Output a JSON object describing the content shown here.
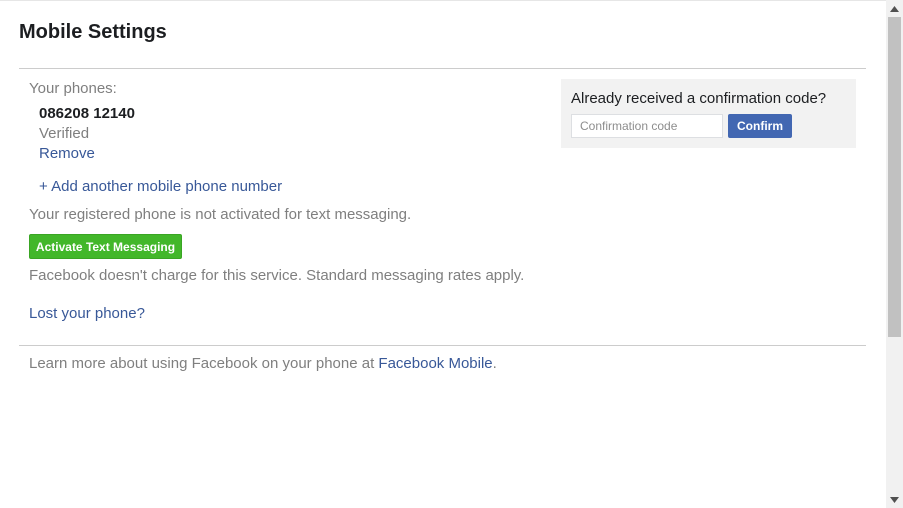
{
  "page": {
    "title": "Mobile Settings"
  },
  "phones": {
    "label": "Your phones:",
    "number": "086208 12140",
    "status": "Verified",
    "remove_label": "Remove",
    "add_label": "+ Add another mobile phone number"
  },
  "texting": {
    "status_text": "Your registered phone is not activated for text messaging.",
    "activate_label": "Activate Text Messaging",
    "charge_note": "Facebook doesn't charge for this service. Standard messaging rates apply.",
    "lost_phone_label": "Lost your phone?"
  },
  "footer": {
    "learn_more_prefix": "Learn more about using Facebook on your phone at ",
    "learn_more_link": "Facebook Mobile",
    "learn_more_suffix": "."
  },
  "confirm": {
    "heading": "Already received a confirmation code?",
    "input_placeholder": "Confirmation code",
    "input_value": "",
    "button_label": "Confirm"
  },
  "scrollbar": {
    "up_icon": "triangle-up-icon",
    "down_icon": "triangle-down-icon"
  },
  "colors": {
    "link": "#385898",
    "activate_button": "#42b72a",
    "confirm_button": "#4267b2",
    "confirm_box_bg": "#f2f2f2"
  }
}
